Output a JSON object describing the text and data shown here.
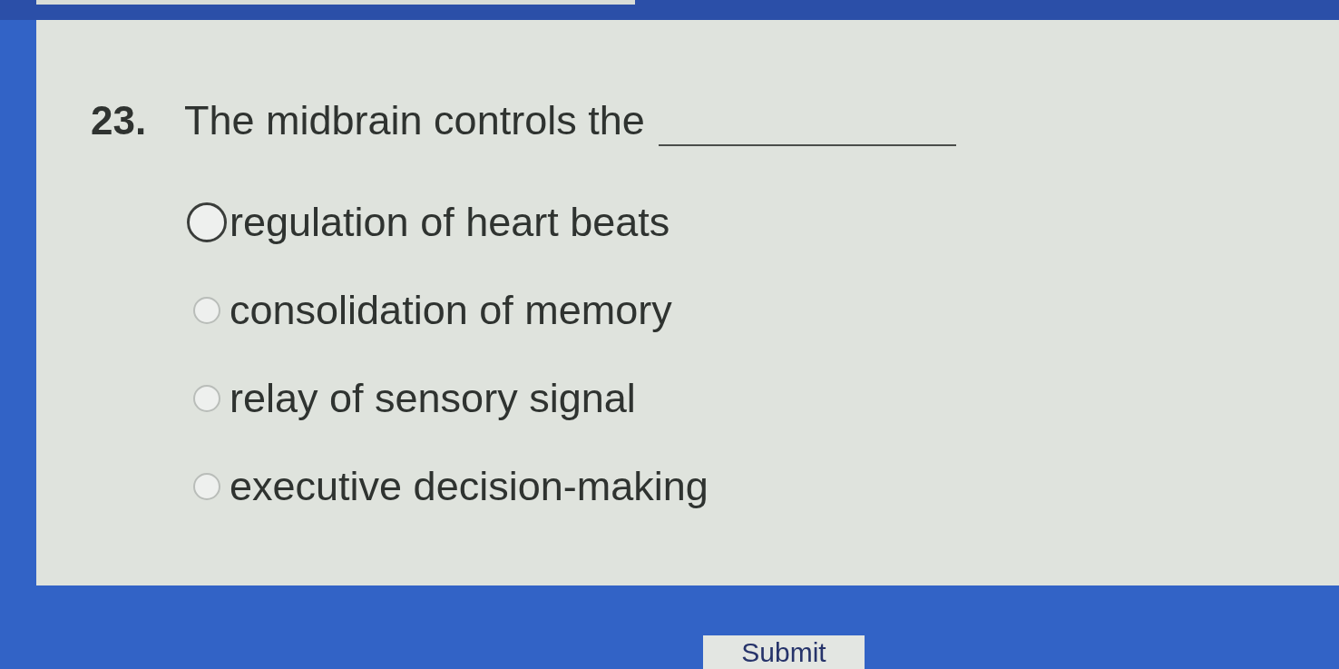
{
  "question": {
    "number": "23.",
    "text": "The midbrain controls the"
  },
  "options": [
    {
      "label": "regulation of heart beats",
      "selected": false,
      "focused": true
    },
    {
      "label": "consolidation of memory",
      "selected": false,
      "focused": false
    },
    {
      "label": "relay of sensory signal",
      "selected": false,
      "focused": false
    },
    {
      "label": "executive decision-making",
      "selected": false,
      "focused": false
    }
  ],
  "submit_button": {
    "label": "Submit"
  }
}
